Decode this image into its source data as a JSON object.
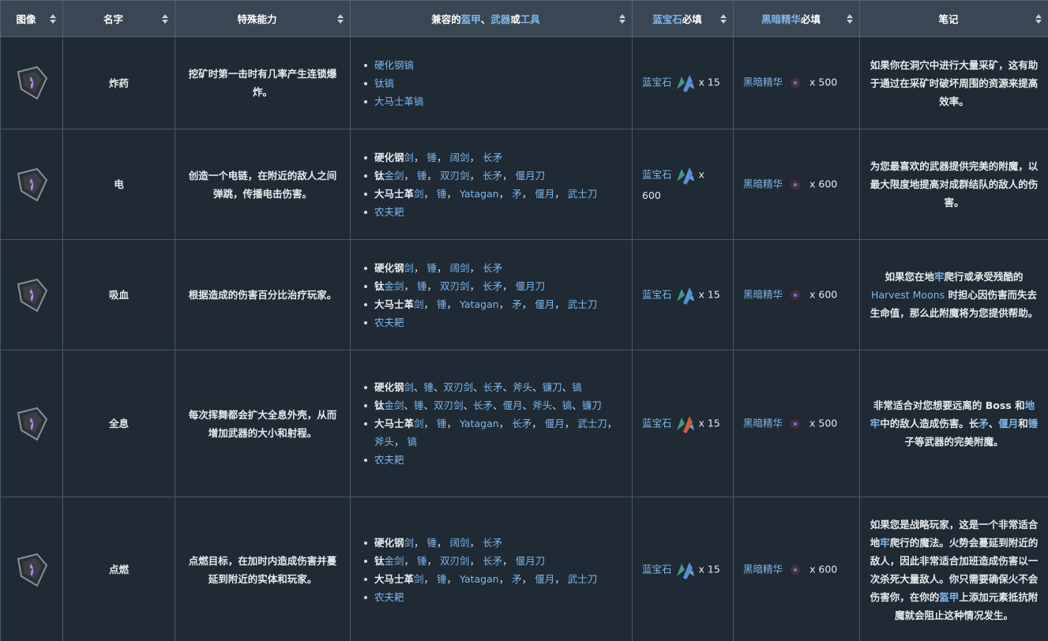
{
  "headers": {
    "image": "图像",
    "name": "名字",
    "ability": "特殊能力",
    "compat_pre": "兼容的",
    "compat_armor": "盔甲",
    "compat_sep": "、",
    "compat_weapon": "武器",
    "compat_or": "或",
    "compat_tool": "工具",
    "sapphire": "蓝宝石",
    "dark": "黑暗精华",
    "required": "必填",
    "notes": "笔记"
  },
  "rows": [
    {
      "name": "炸药",
      "ability": "挖矿时第一击时有几率产生连锁爆炸。",
      "sapphire_label": "蓝宝石",
      "sapphire_qty": "x 15",
      "dark_label": "黑暗精华",
      "dark_qty": "x 500",
      "notes": "如果你在洞穴中进行大量采矿，这有助于通过在采矿时破坏周围的资源来提高效率。"
    },
    {
      "name": "电",
      "ability": "创造一个电链，在附近的敌人之间弹跳，传播电击伤害。",
      "sapphire_label": "蓝宝石",
      "sapphire_qty": "x 600",
      "dark_label": "黑暗精华",
      "dark_qty": "x 600",
      "notes": "为您最喜欢的武器提供完美的附魔，以最大限度地提高对成群结队的敌人的伤害。"
    },
    {
      "name": "吸血",
      "ability": "根据造成的伤害百分比治疗玩家。",
      "sapphire_label": "蓝宝石",
      "sapphire_qty": "x 15",
      "dark_label": "黑暗精华",
      "dark_qty": "x 600",
      "notes_pre": "如果您在地",
      "notes_link1": "牢",
      "notes_mid": "爬行或承受残酷的",
      "notes_link2": "Harvest Moons",
      "notes_post": " 时担心因伤害而失去生命值，那么此附魔将为您提供帮助。"
    },
    {
      "name": "全息",
      "ability": "每次挥舞都会扩大全息外壳，从而增加武器的大小和射程。",
      "sapphire_label": "蓝宝石",
      "sapphire_qty": "x 15",
      "dark_label": "黑暗精华",
      "dark_qty": "x 500",
      "notes_pre": "非常适合对您想要远离的 Boss 和",
      "notes_link1": "地牢",
      "notes_mid": "中的敌人造成伤害。长",
      "notes_link2": "矛",
      "notes_sep": "、",
      "notes_link3": "偃月",
      "notes_and": "和",
      "notes_link4": "锤",
      "notes_post": "子等武器的完美附魔。"
    },
    {
      "name": "点燃",
      "ability": "点燃目标，在加时内造成伤害并蔓延到附近的实体和玩家。",
      "sapphire_label": "蓝宝石",
      "sapphire_qty": "x 15",
      "dark_label": "黑暗精华",
      "dark_qty": "x 600",
      "notes_pre": "如果您是战略玩家，这是一个非常适合地",
      "notes_link1": "牢",
      "notes_mid": "爬行的魔法。火势会蔓延到附近的敌人，因此非常适合加班造成伤害以一次杀死大量敌人。你只需要确保火不会伤害你，在你的",
      "notes_link2": "盔甲",
      "notes_post": "上添加元素抵抗附魔就会阻止这种情况发生。"
    }
  ],
  "compat": {
    "r1": [
      "硬化钢镐",
      "钛镐",
      "大马士革镐"
    ],
    "hardened": "硬化钢",
    "titanium": "钛",
    "damascus": "大马士革",
    "sword": "剑",
    "golden_sword": "金剑",
    "hammer": "锤",
    "rapier": "阔剑",
    "dual_sword": "双刃剑",
    "spear": "长矛",
    "glaive": "偃月刀",
    "glaive_short": "偃月",
    "yatagan": "Yatagan",
    "pike": "矛",
    "katana": "武士刀",
    "katana_short": "武士",
    "katana_tail": "刀",
    "axe": "斧头",
    "scythe": "镰刀",
    "pickaxe": "镐",
    "hoe": "农夫耙",
    "comma": "，",
    "dun": "、",
    "tail_dao": "刀"
  },
  "colors": {
    "link": "#7fb6ea",
    "header_bg": "#3a4653",
    "row_bg": "#1f2a35",
    "border": "#4a5764"
  }
}
